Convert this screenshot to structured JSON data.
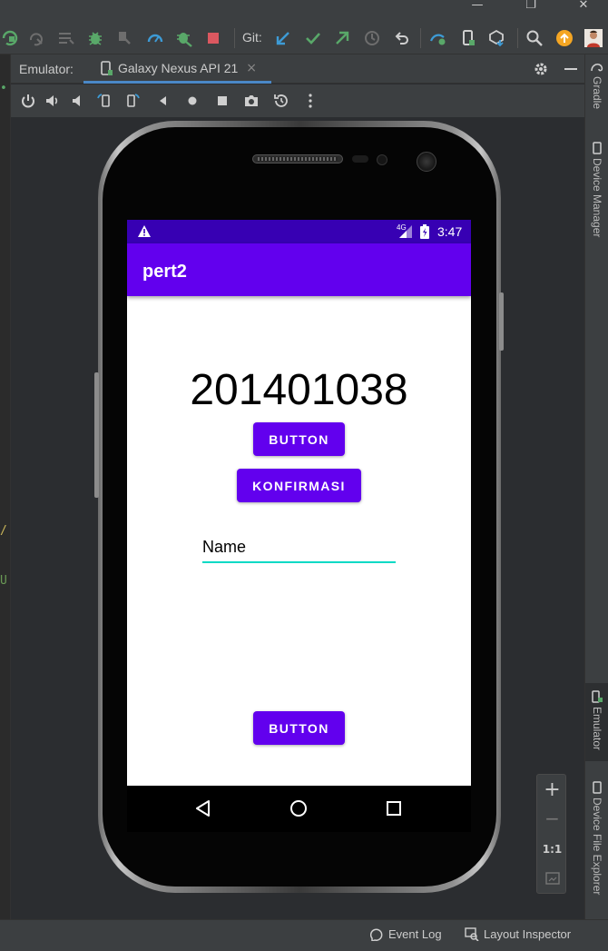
{
  "toolbar": {
    "git_label": "Git:"
  },
  "tool_window": {
    "title": "Emulator:",
    "device_tab": "Galaxy Nexus API 21",
    "tab_close": "×"
  },
  "right_strip": {
    "tabs": [
      "Gradle",
      "Device Manager",
      "Emulator",
      "Device File Explorer"
    ]
  },
  "device": {
    "status_bar": {
      "network": "4G",
      "time": "3:47"
    },
    "app_title": "pert2",
    "number_text": "201401038",
    "button_top": "BUTTON",
    "button_konfirmasi": "KONFIRMASI",
    "name_field_text": "Name",
    "button_bottom": "BUTTON"
  },
  "zoom": {
    "plus": "+",
    "minus": "−",
    "actual_size": "1:1"
  },
  "bottom_bar": {
    "event_log": "Event Log",
    "layout_inspector": "Layout Inspector"
  },
  "colors": {
    "primary": "#6200ee",
    "primary_dark": "#3700b3",
    "accent": "#03dac5",
    "ide_bg": "#3c3f41",
    "tab_underline": "#4a88c7"
  }
}
